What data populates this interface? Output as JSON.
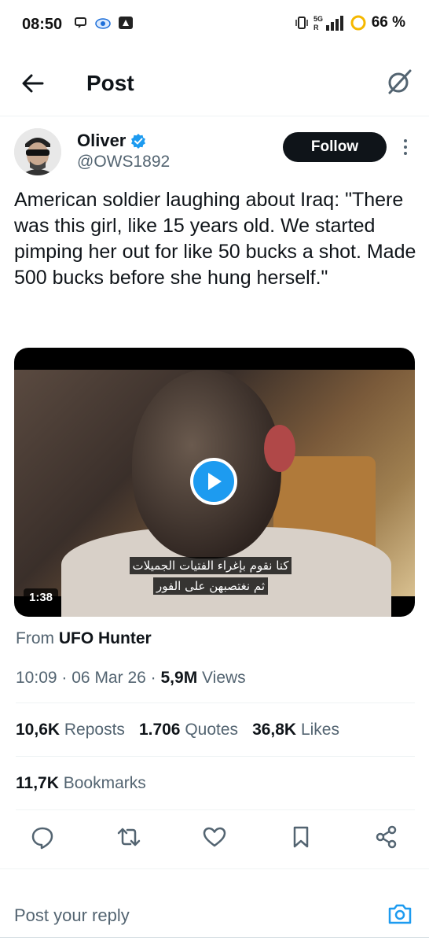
{
  "status_bar": {
    "time": "08:50",
    "battery": "66 %",
    "network": "5G",
    "network_sub": "R"
  },
  "header": {
    "title": "Post"
  },
  "author": {
    "name": "Oliver",
    "handle": "@OWS1892",
    "follow_label": "Follow",
    "verified_color": "#1d9bf0"
  },
  "post": {
    "text": "American soldier laughing about Iraq: \"There was this girl, like 15 years old. We started pimping her out for like 50 bucks a shot. Made 500 bucks before she hung herself.\"",
    "video": {
      "duration": "1:38",
      "subtitle_line1": "كنا نقوم بإغراء الفتيات الجميلات",
      "subtitle_line2": "ثم نغتصبهن على الفور"
    },
    "from_label": "From",
    "from_source": "UFO Hunter",
    "time": "10:09",
    "date": "06 Mar 26",
    "views_count": "5,9M",
    "views_label": "Views"
  },
  "stats": {
    "reposts_count": "10,6K",
    "reposts_label": "Reposts",
    "quotes_count": "1.706",
    "quotes_label": "Quotes",
    "likes_count": "36,8K",
    "likes_label": "Likes",
    "bookmarks_count": "11,7K",
    "bookmarks_label": "Bookmarks"
  },
  "reply": {
    "placeholder": "Post your reply"
  },
  "colors": {
    "accent": "#1d9bf0",
    "text_primary": "#0f1419",
    "text_secondary": "#536471",
    "battery_ring": "#f5b800"
  }
}
